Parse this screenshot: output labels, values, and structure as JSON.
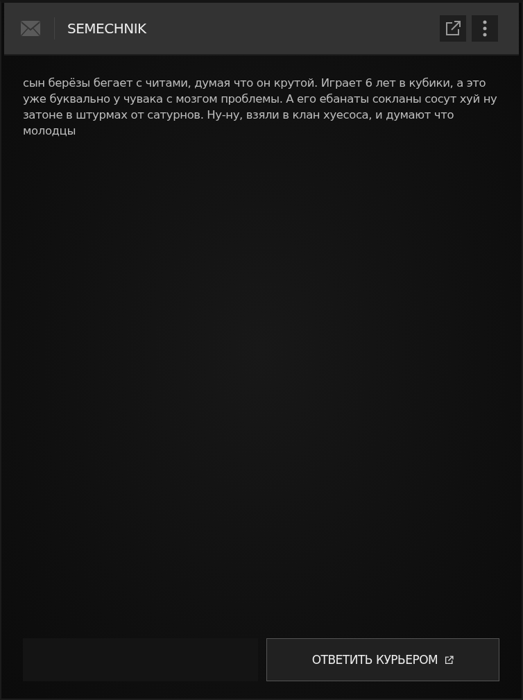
{
  "header": {
    "sender": "SEMECHNIK"
  },
  "message": {
    "text": "сын берёзы бегает с читами, думая что он крутой. Играет 6 лет в кубики, а это уже буквально у чувака с мозгом проблемы. А его ебанаты сокланы сосут хуй ну затоне в штурмах от сатурнов. Ну-ну, взяли в клан хуесоса, и думают что молодцы"
  },
  "reply_button": {
    "label": "ОТВЕТИТЬ КУРЬЕРОМ"
  }
}
